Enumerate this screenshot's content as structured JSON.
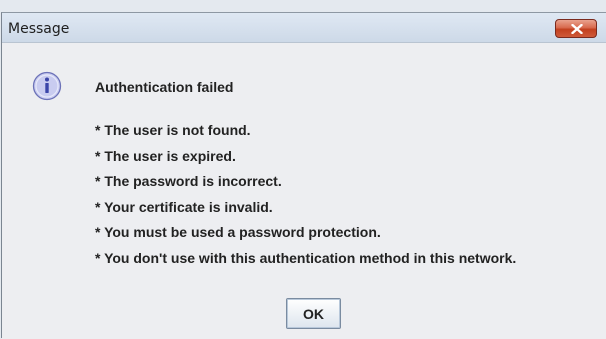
{
  "dialog": {
    "title": "Message",
    "close_icon": "close-icon",
    "info_icon": "info-icon",
    "heading": "Authentication failed",
    "reasons": [
      "* The user is not found.",
      "* The user is expired.",
      "* The password is incorrect.",
      "* Your certificate is invalid.",
      "* You must be used a password protection.",
      "* You don't use with this authentication method in this network."
    ],
    "ok_label": "OK"
  },
  "colors": {
    "close_button": "#c2401f",
    "info_icon_fill": "#c9ccf0",
    "info_icon_text": "#3b45a8",
    "window_background": "#edeef1"
  }
}
